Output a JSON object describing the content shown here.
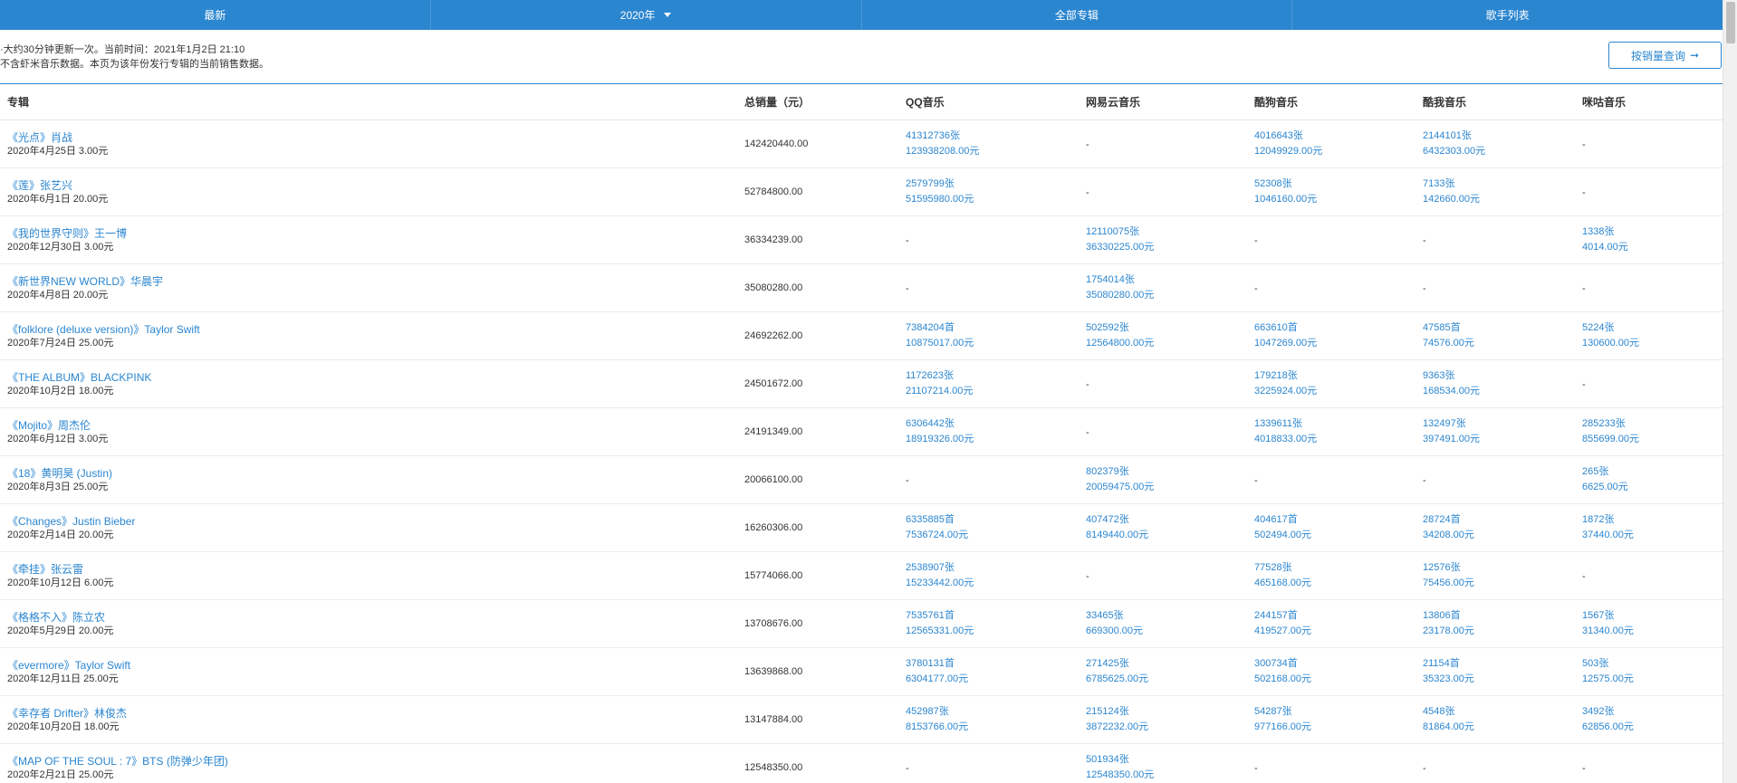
{
  "nav": {
    "tabs": [
      {
        "label": "最新"
      },
      {
        "label": "2020年"
      },
      {
        "label": "全部专辑"
      },
      {
        "label": "歌手列表"
      }
    ]
  },
  "info": {
    "line1": "·大约30分钟更新一次。当前时间：2021年1月2日 21:10",
    "line2": "不含虾米音乐数据。本页为该年份发行专辑的当前销售数据。"
  },
  "query_button": {
    "label": "按销量查询",
    "arrow": "➞"
  },
  "colors": {
    "accent": "#2b86d0"
  },
  "table": {
    "headers": [
      "专辑",
      "总销量（元）",
      "QQ音乐",
      "网易云音乐",
      "酷狗音乐",
      "酷我音乐",
      "咪咕音乐"
    ],
    "rows": [
      {
        "title": "《光点》肖战",
        "meta": "2020年4月25日  3.00元",
        "total": "142420440.00",
        "platforms": [
          [
            "41312736张",
            "123938208.00元"
          ],
          [
            "-",
            ""
          ],
          [
            "4016643张",
            "12049929.00元"
          ],
          [
            "2144101张",
            "6432303.00元"
          ],
          [
            "-",
            ""
          ]
        ]
      },
      {
        "title": "《莲》张艺兴",
        "meta": "2020年6月1日  20.00元",
        "total": "52784800.00",
        "platforms": [
          [
            "2579799张",
            "51595980.00元"
          ],
          [
            "-",
            ""
          ],
          [
            "52308张",
            "1046160.00元"
          ],
          [
            "7133张",
            "142660.00元"
          ],
          [
            "-",
            ""
          ]
        ]
      },
      {
        "title": "《我的世界守则》王一博",
        "meta": "2020年12月30日  3.00元",
        "total": "36334239.00",
        "platforms": [
          [
            "-",
            ""
          ],
          [
            "12110075张",
            "36330225.00元"
          ],
          [
            "-",
            ""
          ],
          [
            "-",
            ""
          ],
          [
            "1338张",
            "4014.00元"
          ]
        ]
      },
      {
        "title": "《新世界NEW WORLD》华晨宇",
        "meta": "2020年4月8日  20.00元",
        "total": "35080280.00",
        "platforms": [
          [
            "-",
            ""
          ],
          [
            "1754014张",
            "35080280.00元"
          ],
          [
            "-",
            ""
          ],
          [
            "-",
            ""
          ],
          [
            "-",
            ""
          ]
        ]
      },
      {
        "title": "《folklore (deluxe version)》Taylor Swift",
        "meta": "2020年7月24日  25.00元",
        "total": "24692262.00",
        "platforms": [
          [
            "7384204首",
            "10875017.00元"
          ],
          [
            "502592张",
            "12564800.00元"
          ],
          [
            "663610首",
            "1047269.00元"
          ],
          [
            "47585首",
            "74576.00元"
          ],
          [
            "5224张",
            "130600.00元"
          ]
        ]
      },
      {
        "title": "《THE ALBUM》BLACKPINK",
        "meta": "2020年10月2日  18.00元",
        "total": "24501672.00",
        "platforms": [
          [
            "1172623张",
            "21107214.00元"
          ],
          [
            "-",
            ""
          ],
          [
            "179218张",
            "3225924.00元"
          ],
          [
            "9363张",
            "168534.00元"
          ],
          [
            "-",
            ""
          ]
        ]
      },
      {
        "title": "《Mojito》周杰伦",
        "meta": "2020年6月12日  3.00元",
        "total": "24191349.00",
        "platforms": [
          [
            "6306442张",
            "18919326.00元"
          ],
          [
            "-",
            ""
          ],
          [
            "1339611张",
            "4018833.00元"
          ],
          [
            "132497张",
            "397491.00元"
          ],
          [
            "285233张",
            "855699.00元"
          ]
        ]
      },
      {
        "title": "《18》黄明昊 (Justin)",
        "meta": "2020年8月3日  25.00元",
        "total": "20066100.00",
        "platforms": [
          [
            "-",
            ""
          ],
          [
            "802379张",
            "20059475.00元"
          ],
          [
            "-",
            ""
          ],
          [
            "-",
            ""
          ],
          [
            "265张",
            "6625.00元"
          ]
        ]
      },
      {
        "title": "《Changes》Justin Bieber",
        "meta": "2020年2月14日  20.00元",
        "total": "16260306.00",
        "platforms": [
          [
            "6335885首",
            "7536724.00元"
          ],
          [
            "407472张",
            "8149440.00元"
          ],
          [
            "404617首",
            "502494.00元"
          ],
          [
            "28724首",
            "34208.00元"
          ],
          [
            "1872张",
            "37440.00元"
          ]
        ]
      },
      {
        "title": "《牵挂》张云雷",
        "meta": "2020年10月12日  6.00元",
        "total": "15774066.00",
        "platforms": [
          [
            "2538907张",
            "15233442.00元"
          ],
          [
            "-",
            ""
          ],
          [
            "77528张",
            "465168.00元"
          ],
          [
            "12576张",
            "75456.00元"
          ],
          [
            "-",
            ""
          ]
        ]
      },
      {
        "title": "《格格不入》陈立农",
        "meta": "2020年5月29日  20.00元",
        "total": "13708676.00",
        "platforms": [
          [
            "7535761首",
            "12565331.00元"
          ],
          [
            "33465张",
            "669300.00元"
          ],
          [
            "244157首",
            "419527.00元"
          ],
          [
            "13806首",
            "23178.00元"
          ],
          [
            "1567张",
            "31340.00元"
          ]
        ]
      },
      {
        "title": "《evermore》Taylor Swift",
        "meta": "2020年12月11日  25.00元",
        "total": "13639868.00",
        "platforms": [
          [
            "3780131首",
            "6304177.00元"
          ],
          [
            "271425张",
            "6785625.00元"
          ],
          [
            "300734首",
            "502168.00元"
          ],
          [
            "21154首",
            "35323.00元"
          ],
          [
            "503张",
            "12575.00元"
          ]
        ]
      },
      {
        "title": "《幸存者 Drifter》林俊杰",
        "meta": "2020年10月20日  18.00元",
        "total": "13147884.00",
        "platforms": [
          [
            "452987张",
            "8153766.00元"
          ],
          [
            "215124张",
            "3872232.00元"
          ],
          [
            "54287张",
            "977166.00元"
          ],
          [
            "4548张",
            "81864.00元"
          ],
          [
            "3492张",
            "62856.00元"
          ]
        ]
      },
      {
        "title": "《MAP OF THE SOUL : 7》BTS (防弹少年团)",
        "meta": "2020年2月21日  25.00元",
        "total": "12548350.00",
        "platforms": [
          [
            "-",
            ""
          ],
          [
            "501934张",
            "12548350.00元"
          ],
          [
            "-",
            ""
          ],
          [
            "-",
            ""
          ],
          [
            "-",
            ""
          ]
        ]
      }
    ]
  }
}
